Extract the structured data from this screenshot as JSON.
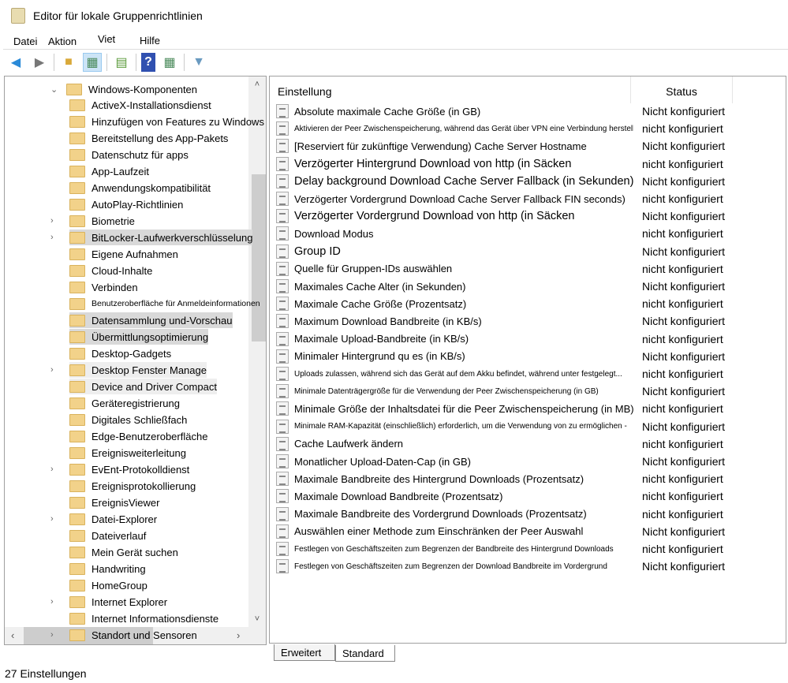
{
  "window": {
    "title": "Editor für lokale Gruppenrichtlinien"
  },
  "menu": [
    "Datei",
    "Aktion",
    "Viet",
    "Hilfe"
  ],
  "toolbar": [
    "back-arrow-icon",
    "forward-arrow-icon",
    "up-folder-icon",
    "show-hide-tree-icon",
    "export-list-icon",
    "help-icon",
    "action-pane-icon",
    "filter-icon"
  ],
  "tree": {
    "root": "Windows-Komponenten",
    "items": [
      {
        "label": "ActiveX-Installationsdienst"
      },
      {
        "label": "Hinzufügen von Features zu Windows"
      },
      {
        "label": "Bereitstellung des App-Pakets"
      },
      {
        "label": "Datenschutz für apps"
      },
      {
        "label": "App-Laufzeit"
      },
      {
        "label": "Anwendungskompatibilität"
      },
      {
        "label": "AutoPlay-Richtlinien"
      },
      {
        "label": "Biometrie",
        "expandable": true
      },
      {
        "label": "BitLocker-Laufwerkverschlüsselung",
        "expandable": true,
        "highlight": true
      },
      {
        "label": "Eigene Aufnahmen"
      },
      {
        "label": "Cloud-Inhalte"
      },
      {
        "label": "Verbinden"
      },
      {
        "label": "Benutzeroberfläche für Anmeldeinformationen",
        "small": true
      },
      {
        "label": "Datensammlung und-Vorschau",
        "highlight": true
      },
      {
        "label": "Übermittlungsoptimierung",
        "highlight": true,
        "selected": true
      },
      {
        "label": "Desktop-Gadgets"
      },
      {
        "label": "Desktop Fenster Manage",
        "expandable": true,
        "light": true
      },
      {
        "label": "Device and Driver Compact",
        "light": true
      },
      {
        "label": "Geräteregistrierung"
      },
      {
        "label": "Digitales Schließfach"
      },
      {
        "label": "Edge-Benutzeroberfläche"
      },
      {
        "label": "Ereignisweiterleitung"
      },
      {
        "label": "EvEnt-Protokolldienst",
        "expandable": true
      },
      {
        "label": "Ereignisprotokollierung"
      },
      {
        "label": "EreignisViewer"
      },
      {
        "label": "Datei-Explorer",
        "expandable": true
      },
      {
        "label": "Dateiverlauf"
      },
      {
        "label": "Mein Gerät suchen"
      },
      {
        "label": "Handwriting"
      },
      {
        "label": "HomeGroup"
      },
      {
        "label": "Internet Explorer",
        "expandable": true
      },
      {
        "label": "Internet Informationsdienste"
      },
      {
        "label": "Standort und Sensoren",
        "expandable": true
      }
    ]
  },
  "list": {
    "headers": {
      "setting": "Einstellung",
      "status": "Status"
    },
    "rows": [
      {
        "name": "Absolute maximale Cache Größe (in GB)",
        "status": "Nicht konfiguriert"
      },
      {
        "name": "Aktivieren der Peer Zwischenspeicherung, während das Gerät über VPN eine Verbindung herstellt",
        "status": "nicht konfiguriert",
        "small": true
      },
      {
        "name": "[Reserviert für zukünftige Verwendung) Cache Server Hostname",
        "status": "Nicht konfiguriert"
      },
      {
        "name": "Verzögerter Hintergrund Download von http (in Säcken",
        "status": "nicht konfiguriert",
        "big": true
      },
      {
        "name": "Delay background Download Cache Server Fallback (in Sekunden)",
        "status": "Nicht konfiguriert",
        "big": true
      },
      {
        "name": "Verzögerter Vordergrund Download Cache Server Fallback FIN seconds)",
        "status": "nicht konfiguriert"
      },
      {
        "name": "Verzögerter Vordergrund Download von http (in Säcken",
        "status": "Nicht konfiguriert",
        "big": true
      },
      {
        "name": "Download Modus",
        "status": "nicht konfiguriert"
      },
      {
        "name": "Group ID",
        "status": "Nicht konfiguriert",
        "big": true
      },
      {
        "name": "Quelle für Gruppen-IDs auswählen",
        "status": "nicht konfiguriert"
      },
      {
        "name": "Maximales Cache Alter (in Sekunden)",
        "status": "Nicht konfiguriert"
      },
      {
        "name": "Maximale Cache Größe (Prozentsatz)",
        "status": "nicht konfiguriert"
      },
      {
        "name": "Maximum Download Bandbreite (in KB/s)",
        "status": "Nicht konfiguriert"
      },
      {
        "name": "Maximale Upload-Bandbreite (in KB/s)",
        "status": "nicht konfiguriert"
      },
      {
        "name": "Minimaler Hintergrund qu es (in KB/s)",
        "status": "Nicht konfiguriert"
      },
      {
        "name": "Uploads zulassen, während sich das Gerät auf dem Akku befindet, während unter festgelegt...",
        "status": "nicht konfiguriert",
        "small": true
      },
      {
        "name": "Minimale Datenträgergröße für die Verwendung der Peer Zwischenspeicherung (in GB)",
        "status": "Nicht konfiguriert",
        "small": true
      },
      {
        "name": "Minimale Größe der Inhaltsdatei für die Peer Zwischenspeicherung (in MB)",
        "status": "nicht konfiguriert"
      },
      {
        "name": "Minimale RAM-Kapazität (einschließlich) erforderlich, um die Verwendung von zu ermöglichen -",
        "status": "Nicht konfiguriert",
        "small": true
      },
      {
        "name": "Cache Laufwerk ändern",
        "status": "nicht konfiguriert"
      },
      {
        "name": "Monatlicher Upload-Daten-Cap (in GB)",
        "status": "Nicht konfiguriert"
      },
      {
        "name": "Maximale Bandbreite des Hintergrund Downloads (Prozentsatz)",
        "status": "nicht konfiguriert"
      },
      {
        "name": "Maximale Download Bandbreite (Prozentsatz)",
        "status": "nicht konfiguriert"
      },
      {
        "name": "Maximale Bandbreite des Vordergrund Downloads (Prozentsatz)",
        "status": "nicht konfiguriert"
      },
      {
        "name": "Auswählen einer Methode zum Einschränken der Peer Auswahl",
        "status": "Nicht konfiguriert"
      },
      {
        "name": "Festlegen von Geschäftszeiten zum Begrenzen der Bandbreite des Hintergrund Downloads",
        "status": "nicht konfiguriert",
        "small": true
      },
      {
        "name": "Festlegen von Geschäftszeiten zum Begrenzen der Download Bandbreite im Vordergrund",
        "status": "Nicht konfiguriert",
        "small": true
      }
    ]
  },
  "tabs": [
    "Erweitert",
    "Standard"
  ],
  "statusbar": {
    "count": "27",
    "label": "Einstellungen"
  }
}
